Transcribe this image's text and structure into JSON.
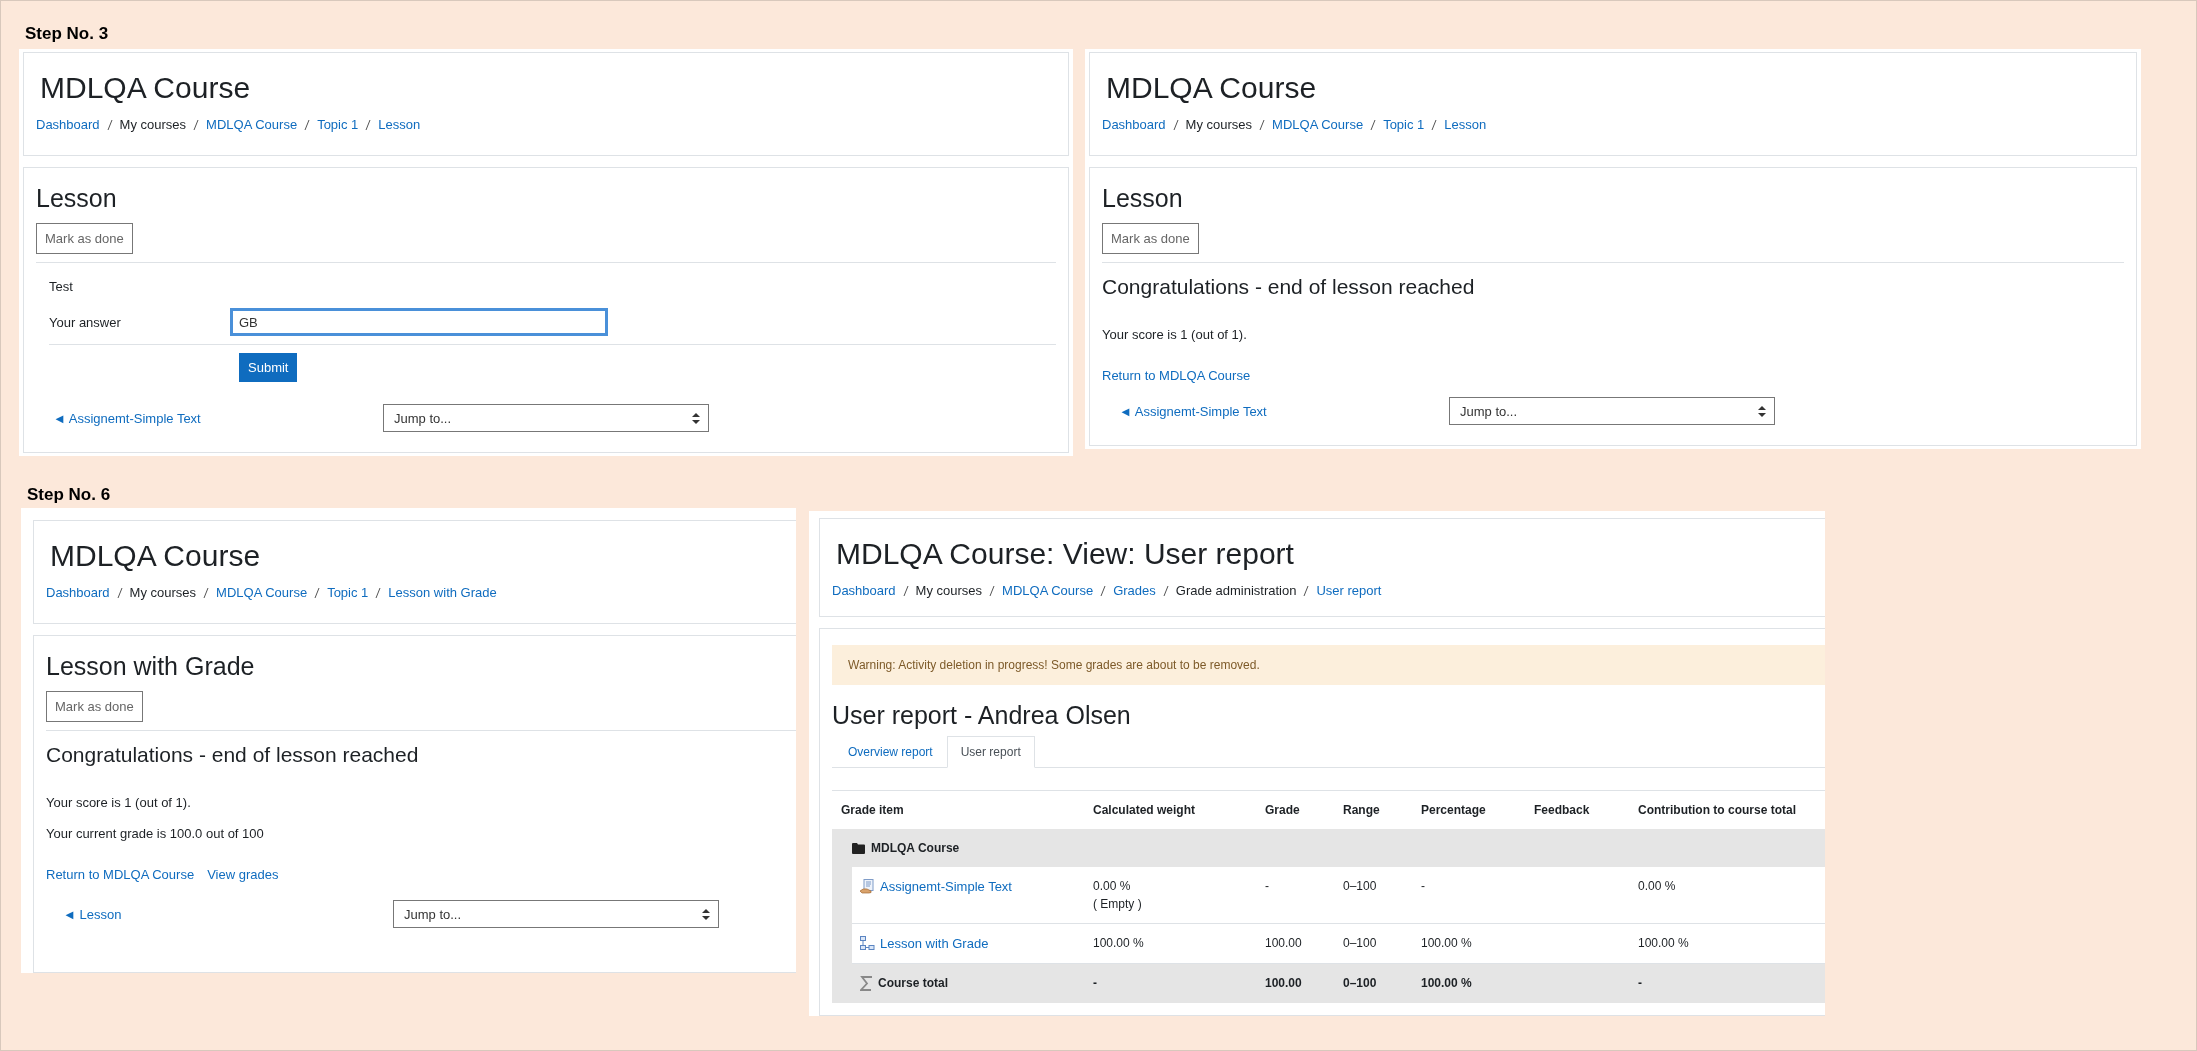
{
  "sections": [
    {
      "heading": "Step No. 3",
      "screens": [
        {
          "kind": "lesson_question",
          "header": {
            "title": "MDLQA Course",
            "breadcrumb": [
              {
                "text": "Dashboard",
                "link": true
              },
              {
                "text": "My courses",
                "link": false
              },
              {
                "text": "MDLQA Course",
                "link": true
              },
              {
                "text": "Topic 1",
                "link": true
              },
              {
                "text": "Lesson",
                "link": true
              }
            ]
          },
          "heading": "Lesson",
          "mark_button": "Mark as done",
          "question": "Test",
          "answer_label": "Your answer",
          "answer": {
            "value": "GB",
            "focused": true
          },
          "submit": "Submit",
          "nav": {
            "previous": "◄ Assignemt-Simple Text",
            "jump": "Jump to..."
          }
        },
        {
          "kind": "lesson_end",
          "header": {
            "title": "MDLQA Course",
            "breadcrumb": [
              {
                "text": "Dashboard",
                "link": true
              },
              {
                "text": "My courses",
                "link": false
              },
              {
                "text": "MDLQA Course",
                "link": true
              },
              {
                "text": "Topic 1",
                "link": true
              },
              {
                "text": "Lesson",
                "link": true
              }
            ]
          },
          "heading": "Lesson",
          "mark_button": "Mark as done",
          "end_heading": "Congratulations - end of lesson reached",
          "paragraphs": [
            "Your score is 1 (out of 1)."
          ],
          "links": [
            "Return to MDLQA Course"
          ],
          "nav": {
            "previous": "◄ Assignemt-Simple Text",
            "jump": "Jump to..."
          }
        }
      ]
    },
    {
      "heading": "Step No. 6",
      "screens": [
        {
          "kind": "lesson_end",
          "header": {
            "title": "MDLQA Course",
            "breadcrumb": [
              {
                "text": "Dashboard",
                "link": true
              },
              {
                "text": "My courses",
                "link": false
              },
              {
                "text": "MDLQA Course",
                "link": true
              },
              {
                "text": "Topic 1",
                "link": true
              },
              {
                "text": "Lesson with Grade",
                "link": true
              }
            ]
          },
          "heading": "Lesson with Grade",
          "mark_button": "Mark as done",
          "end_heading": "Congratulations - end of lesson reached",
          "paragraphs": [
            "Your score is 1 (out of 1).",
            "Your current grade is 100.0 out of 100"
          ],
          "links": [
            "Return to MDLQA Course",
            "View grades"
          ],
          "nav": {
            "previous": "◄ Lesson",
            "jump": "Jump to..."
          }
        },
        {
          "kind": "grade_report",
          "header": {
            "title": "MDLQA Course: View: User report",
            "breadcrumb": [
              {
                "text": "Dashboard",
                "link": true
              },
              {
                "text": "My courses",
                "link": false
              },
              {
                "text": "MDLQA Course",
                "link": true
              },
              {
                "text": "Grades",
                "link": true
              },
              {
                "text": "Grade administration",
                "link": false
              },
              {
                "text": "User report",
                "link": true
              }
            ]
          },
          "warning": "Warning: Activity deletion in progress! Some grades are about to be removed.",
          "heading": "User report - Andrea Olsen",
          "tabs": [
            {
              "label": "Overview report",
              "selected": false
            },
            {
              "label": "User report",
              "selected": true
            }
          ],
          "table": {
            "columns": [
              "Grade item",
              "Calculated weight",
              "Grade",
              "Range",
              "Percentage",
              "Feedback",
              "Contribution to course total"
            ],
            "rows": [
              {
                "kind": "category",
                "item": "MDLQA Course"
              },
              {
                "kind": "assignment",
                "item": "Assignemt-Simple Text",
                "weight": "0.00 %",
                "weight_note": "( Empty )",
                "grade": "-",
                "range": "0–100",
                "percentage": "-",
                "contribution": "0.00 %"
              },
              {
                "kind": "lesson",
                "item": "Lesson with Grade",
                "weight": "100.00 %",
                "grade": "100.00",
                "range": "0–100",
                "percentage": "100.00 %",
                "contribution": "100.00 %"
              },
              {
                "kind": "total",
                "item": "Course total",
                "weight": "-",
                "grade": "100.00",
                "range": "0–100",
                "percentage": "100.00 %",
                "contribution": "-"
              }
            ]
          }
        }
      ]
    }
  ]
}
